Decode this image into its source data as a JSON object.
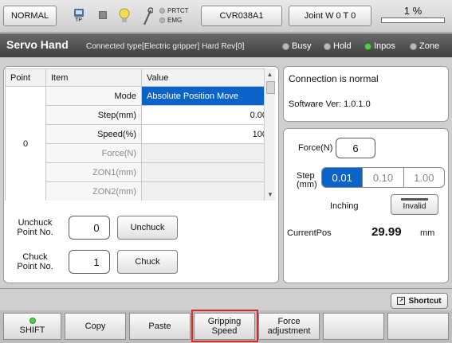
{
  "topbar": {
    "mode": "NORMAL",
    "tp_label": "TP",
    "prtct": "PRTCT",
    "emg": "EMG",
    "program": "CVR038A1",
    "joint": "Joint  W 0 T 0",
    "speed": "1 %"
  },
  "header": {
    "title": "Servo Hand",
    "subtitle": "Connected type[Electric gripper]  Hard Rev[0]",
    "indicators": [
      {
        "label": "Busy",
        "on": false
      },
      {
        "label": "Hold",
        "on": false
      },
      {
        "label": "Inpos",
        "on": true
      },
      {
        "label": "Zone",
        "on": false
      }
    ]
  },
  "table": {
    "headers": [
      "Point",
      "Item",
      "Value"
    ],
    "point": "0",
    "rows": [
      {
        "item": "Mode",
        "value": "Absolute Position Move"
      },
      {
        "item": "Step(mm)",
        "value": "0.00"
      },
      {
        "item": "Speed(%)",
        "value": "100"
      },
      {
        "item": "Force(N)",
        "value": ""
      },
      {
        "item": "ZON1(mm)",
        "value": ""
      },
      {
        "item": "ZON2(mm)",
        "value": ""
      }
    ]
  },
  "unchuck": {
    "label": "Unchuck\nPoint No.",
    "value": "0",
    "button": "Unchuck"
  },
  "chuck": {
    "label": "Chuck\nPoint No.",
    "value": "1",
    "button": "Chuck"
  },
  "connection": {
    "status": "Connection is normal",
    "version": "Software Ver: 1.0.1.0"
  },
  "control": {
    "force_label": "Force(N)",
    "force_value": "6",
    "step_label": "Step\n(mm)",
    "steps": [
      "0.01",
      "0.10",
      "1.00"
    ],
    "step_selected": "0.01",
    "inching_label": "Inching",
    "inching_button": "Invalid",
    "currentpos_label": "CurrentPos",
    "currentpos_value": "29.99",
    "currentpos_unit": "mm"
  },
  "shortcut": "Shortcut",
  "footer": [
    "SHIFT",
    "Copy",
    "Paste",
    "Gripping\nSpeed",
    "Force\nadjustment",
    "",
    ""
  ],
  "colors": {
    "selected": "#0a64c8",
    "highlight_border": "#d32a2a",
    "inpos": "#52d04a"
  }
}
